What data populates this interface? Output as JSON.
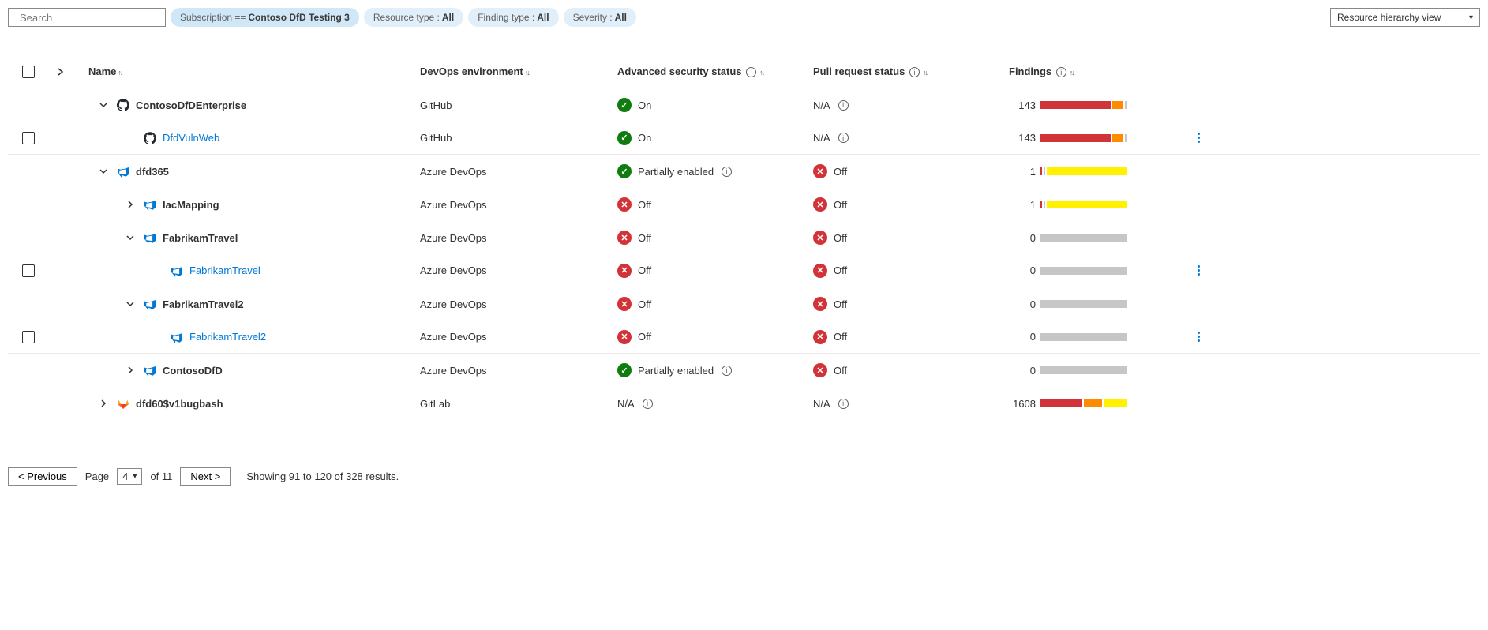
{
  "search": {
    "placeholder": "Search"
  },
  "filters": {
    "subscription": {
      "label": "Subscription ==",
      "value": "Contoso DfD Testing 3"
    },
    "resourceType": {
      "label": "Resource type :",
      "value": "All"
    },
    "findingType": {
      "label": "Finding type :",
      "value": "All"
    },
    "severity": {
      "label": "Severity :",
      "value": "All"
    }
  },
  "viewSelector": "Resource hierarchy view",
  "columns": {
    "name": "Name",
    "env": "DevOps environment",
    "adv": "Advanced security status",
    "pr": "Pull request status",
    "find": "Findings"
  },
  "statusLabels": {
    "on": "On",
    "off": "Off",
    "partial": "Partially enabled",
    "na": "N/A"
  },
  "rows": [
    {
      "indent": 0,
      "chev": "down",
      "icon": "github",
      "name": "ContosoDfDEnterprise",
      "link": false,
      "env": "GitHub",
      "adv": "on-on",
      "pr": "na-info",
      "findings": {
        "n": "143",
        "bar": "github143"
      }
    },
    {
      "indent": 1,
      "chev": "none",
      "icon": "github",
      "name": "DfdVulnWeb",
      "link": true,
      "env": "GitHub",
      "adv": "on-on",
      "pr": "na-info",
      "findings": {
        "n": "143",
        "bar": "github143"
      },
      "checkbox": true,
      "menu": true,
      "border": true
    },
    {
      "indent": 0,
      "chev": "down",
      "icon": "ado",
      "name": "dfd365",
      "link": false,
      "env": "Azure DevOps",
      "adv": "on-partial",
      "pr": "off-off",
      "findings": {
        "n": "1",
        "bar": "yellow1"
      }
    },
    {
      "indent": 1,
      "chev": "right",
      "icon": "ado",
      "name": "IacMapping",
      "link": false,
      "env": "Azure DevOps",
      "adv": "off-off",
      "pr": "off-off",
      "findings": {
        "n": "1",
        "bar": "yellow1"
      }
    },
    {
      "indent": 1,
      "chev": "down",
      "icon": "ado",
      "name": "FabrikamTravel",
      "link": false,
      "env": "Azure DevOps",
      "adv": "off-off",
      "pr": "off-off",
      "findings": {
        "n": "0",
        "bar": "gray"
      }
    },
    {
      "indent": 2,
      "chev": "none",
      "icon": "ado",
      "name": "FabrikamTravel",
      "link": true,
      "env": "Azure DevOps",
      "adv": "off-off",
      "pr": "off-off",
      "findings": {
        "n": "0",
        "bar": "gray"
      },
      "checkbox": true,
      "menu": true,
      "border": true
    },
    {
      "indent": 1,
      "chev": "down",
      "icon": "ado",
      "name": "FabrikamTravel2",
      "link": false,
      "env": "Azure DevOps",
      "adv": "off-off",
      "pr": "off-off",
      "findings": {
        "n": "0",
        "bar": "gray"
      }
    },
    {
      "indent": 2,
      "chev": "none",
      "icon": "ado",
      "name": "FabrikamTravel2",
      "link": true,
      "env": "Azure DevOps",
      "adv": "off-off",
      "pr": "off-off",
      "findings": {
        "n": "0",
        "bar": "gray"
      },
      "checkbox": true,
      "menu": true,
      "border": true
    },
    {
      "indent": 1,
      "chev": "right",
      "icon": "ado",
      "name": "ContosoDfD",
      "link": false,
      "env": "Azure DevOps",
      "adv": "on-partial",
      "pr": "off-off",
      "findings": {
        "n": "0",
        "bar": "gray"
      }
    },
    {
      "indent": 0,
      "chev": "right",
      "icon": "gitlab",
      "name": "dfd60$v1bugbash",
      "link": false,
      "env": "GitLab",
      "adv": "na-info",
      "pr": "na-info",
      "findings": {
        "n": "1608",
        "bar": "gitlab1608"
      }
    }
  ],
  "pagination": {
    "prev": "< Previous",
    "next": "Next >",
    "pageLabel": "Page",
    "page": "4",
    "ofLabel": "of 11",
    "showing": "Showing 91 to 120 of 328 results."
  }
}
